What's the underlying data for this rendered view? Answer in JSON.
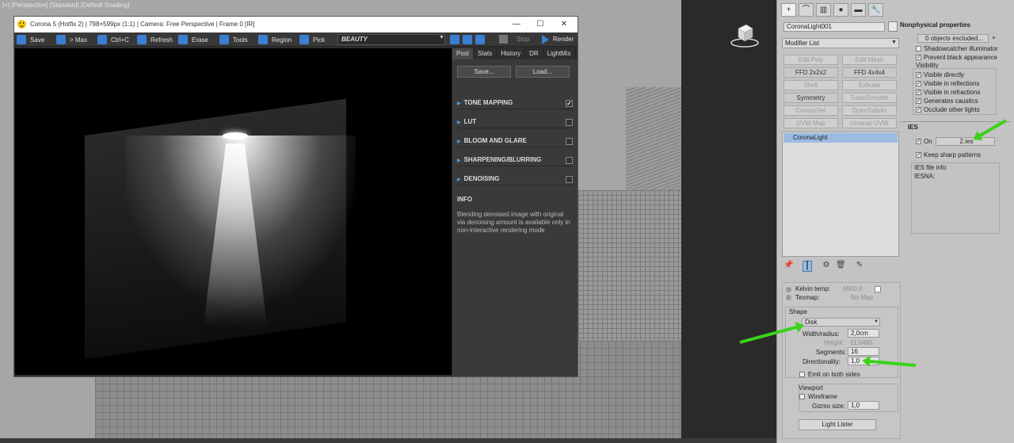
{
  "viewport": {
    "label": "[+] [Perspective] [Standard] [Default Shading]"
  },
  "vfb": {
    "title": "Corona 5 (Hotfix 2) | 798×599px (1:1) | Camera: Free Perspective | Frame 0 [IR]",
    "window_controls": {
      "minimize": "—",
      "maximize": "☐",
      "close": "✕"
    },
    "toolbar": {
      "save": "Save",
      "max": "> Max",
      "ctrlc": "Ctrl+C",
      "refresh": "Refresh",
      "erase": "Erase",
      "tools": "Tools",
      "region": "Region",
      "pick": "Pick",
      "channel": "BEAUTY",
      "stop": "Stop",
      "render": "Render"
    },
    "tabs": [
      "Post",
      "Stats",
      "History",
      "DR",
      "LightMix"
    ],
    "save_button": "Save...",
    "load_button": "Load...",
    "sections": [
      {
        "label": "TONE MAPPING",
        "checked": "✓"
      },
      {
        "label": "LUT",
        "checked": ""
      },
      {
        "label": "BLOOM AND GLARE",
        "checked": ""
      },
      {
        "label": "SHARPENING/BLURRING",
        "checked": ""
      },
      {
        "label": "DENOISING",
        "checked": ""
      }
    ],
    "info": {
      "title": "INFO",
      "text": "Blending denoised image with original via denoising amount is available only in non-interactive rendering mode"
    }
  },
  "command_panel": {
    "tabs": [
      "+",
      "⌒",
      "▥",
      "●",
      "▬",
      "🔧"
    ],
    "object_name": "CoronaLight001",
    "modifier_list": "Modifier List",
    "modifiers": [
      "Edit Poly",
      "Edit Mesh",
      "FFD 2x2x2",
      "FFD 4x4x4",
      "Shell",
      "Extrude",
      "Symmetry",
      "TurboSmooth",
      "CreaseSet",
      "OpenSubdiv",
      "UVW Map",
      "Unwrap UVW"
    ],
    "stack_item": "CoronaLight",
    "stack_icons": [
      "📌",
      "┃",
      "⚙",
      "🗑",
      "✎"
    ],
    "left_rollout": {
      "kelvin_label": "Kelvin temp:",
      "kelvin_value": "6500,0",
      "texmap_label": "Texmap:",
      "texmap_value": "No Map",
      "shape_title": "Shape",
      "shape_value": "Disk",
      "width_label": "Width/radius:",
      "width_value": "2,0cm",
      "height_label": "Height:",
      "height_value": "11,0495",
      "segments_label": "Segments:",
      "segments_value": "16",
      "directionality_label": "Directionality:",
      "directionality_value": "1,0",
      "emit_label": "Emit on both sides",
      "viewport_title": "Viewport",
      "wireframe_label": "Wireframe",
      "gizmo_label": "Gizmo size:",
      "gizmo_value": "1,0",
      "light_lister": "Light Lister"
    },
    "right_rollout": {
      "nonphysical_title": "Nonphysical properties",
      "objects_excluded": "0 objects excluded...",
      "plus": "+",
      "shadowcatcher": "Shadowcatcher illuminator",
      "prevent_black": "Prevent black appearance",
      "visibility_title": "Visibility",
      "visibility_items": [
        "Visible directly",
        "Visible in reflections",
        "Visible in refractions",
        "Generates caustics",
        "Occlude other lights"
      ],
      "ies_title": "IES",
      "ies_on": "On",
      "ies_file": "2.ies",
      "keep_sharp": "Keep sharp patterns",
      "ies_info_title": "IES file info",
      "ies_info_value": "IESNA:"
    }
  },
  "colors": {
    "accent": "#3b7fd1",
    "arrow": "#3bd21a",
    "selection": "#9cbbe3"
  }
}
